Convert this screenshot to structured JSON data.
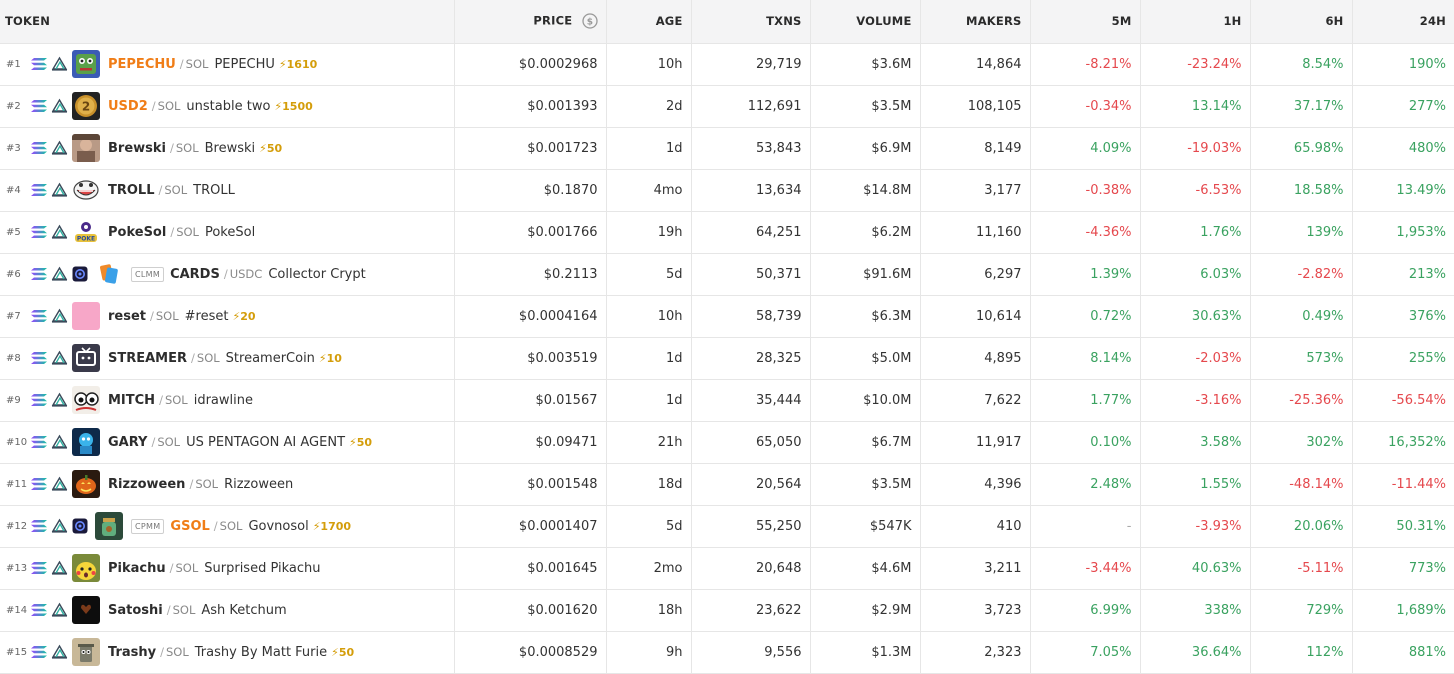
{
  "columns": {
    "token": "TOKEN",
    "price": "PRICE",
    "age": "AGE",
    "txns": "TXNS",
    "volume": "VOLUME",
    "makers": "MAKERS",
    "m5": "5M",
    "h1": "1H",
    "h6": "6H",
    "h24": "24H"
  },
  "colors": {
    "positive": "#3aa260",
    "negative": "#e5484d",
    "highlight_symbol": "#f07d17",
    "boost": "#d49d0a"
  },
  "rows": [
    {
      "rank": "#1",
      "symbol": "PEPECHU",
      "symbol_orange": true,
      "quote": "SOL",
      "name": "PEPECHU",
      "boost": "⚡1610",
      "tag": "",
      "extra_icon": false,
      "price": "$0.0002968",
      "age": "10h",
      "txns": "29,719",
      "volume": "$3.6M",
      "makers": "14,864",
      "m5": "-8.21%",
      "h1": "-23.24%",
      "h6": "8.54%",
      "h24": "190%",
      "avatar": "pepe-avatar"
    },
    {
      "rank": "#2",
      "symbol": "USD2",
      "symbol_orange": true,
      "quote": "SOL",
      "name": "unstable two",
      "boost": "⚡1500",
      "tag": "",
      "extra_icon": false,
      "price": "$0.001393",
      "age": "2d",
      "txns": "112,691",
      "volume": "$3.5M",
      "makers": "108,105",
      "m5": "-0.34%",
      "h1": "13.14%",
      "h6": "37.17%",
      "h24": "277%",
      "avatar": "coin-2-avatar"
    },
    {
      "rank": "#3",
      "symbol": "Brewski",
      "symbol_orange": false,
      "quote": "SOL",
      "name": "Brewski",
      "boost": "⚡50",
      "tag": "",
      "extra_icon": false,
      "price": "$0.001723",
      "age": "1d",
      "txns": "53,843",
      "volume": "$6.9M",
      "makers": "8,149",
      "m5": "4.09%",
      "h1": "-19.03%",
      "h6": "65.98%",
      "h24": "480%",
      "avatar": "photo-avatar"
    },
    {
      "rank": "#4",
      "symbol": "TROLL",
      "symbol_orange": false,
      "quote": "SOL",
      "name": "TROLL",
      "boost": "",
      "tag": "",
      "extra_icon": false,
      "price": "$0.1870",
      "age": "4mo",
      "txns": "13,634",
      "volume": "$14.8M",
      "makers": "3,177",
      "m5": "-0.38%",
      "h1": "-6.53%",
      "h6": "18.58%",
      "h24": "13.49%",
      "avatar": "troll-face-avatar"
    },
    {
      "rank": "#5",
      "symbol": "PokeSol",
      "symbol_orange": false,
      "quote": "SOL",
      "name": "PokeSol",
      "boost": "",
      "tag": "",
      "extra_icon": false,
      "price": "$0.001766",
      "age": "19h",
      "txns": "64,251",
      "volume": "$6.2M",
      "makers": "11,160",
      "m5": "-4.36%",
      "h1": "1.76%",
      "h6": "139%",
      "h24": "1,953%",
      "avatar": "pokesol-logo-avatar"
    },
    {
      "rank": "#6",
      "symbol": "CARDS",
      "symbol_orange": false,
      "quote": "USDC",
      "name": "Collector Crypt",
      "boost": "",
      "tag": "CLMM",
      "extra_icon": true,
      "price": "$0.2113",
      "age": "5d",
      "txns": "50,371",
      "volume": "$91.6M",
      "makers": "6,297",
      "m5": "1.39%",
      "h1": "6.03%",
      "h6": "-2.82%",
      "h24": "213%",
      "avatar": "cards-logo-avatar"
    },
    {
      "rank": "#7",
      "symbol": "reset",
      "symbol_orange": false,
      "quote": "SOL",
      "name": "#reset",
      "boost": "⚡20",
      "tag": "",
      "extra_icon": false,
      "price": "$0.0004164",
      "age": "10h",
      "txns": "58,739",
      "volume": "$6.3M",
      "makers": "10,614",
      "m5": "0.72%",
      "h1": "30.63%",
      "h6": "0.49%",
      "h24": "376%",
      "avatar": "pink-avatar"
    },
    {
      "rank": "#8",
      "symbol": "STREAMER",
      "symbol_orange": false,
      "quote": "SOL",
      "name": "StreamerCoin",
      "boost": "⚡10",
      "tag": "",
      "extra_icon": false,
      "price": "$0.003519",
      "age": "1d",
      "txns": "28,325",
      "volume": "$5.0M",
      "makers": "4,895",
      "m5": "8.14%",
      "h1": "-2.03%",
      "h6": "573%",
      "h24": "255%",
      "avatar": "tv-avatar"
    },
    {
      "rank": "#9",
      "symbol": "MITCH",
      "symbol_orange": false,
      "quote": "SOL",
      "name": "idrawline",
      "boost": "",
      "tag": "",
      "extra_icon": false,
      "price": "$0.01567",
      "age": "1d",
      "txns": "35,444",
      "volume": "$10.0M",
      "makers": "7,622",
      "m5": "1.77%",
      "h1": "-3.16%",
      "h6": "-25.36%",
      "h24": "-56.54%",
      "avatar": "eyes-avatar"
    },
    {
      "rank": "#10",
      "symbol": "GARY",
      "symbol_orange": false,
      "quote": "SOL",
      "name": "US PENTAGON AI AGENT",
      "boost": "⚡50",
      "tag": "",
      "extra_icon": false,
      "price": "$0.09471",
      "age": "21h",
      "txns": "65,050",
      "volume": "$6.7M",
      "makers": "11,917",
      "m5": "0.10%",
      "h1": "3.58%",
      "h6": "302%",
      "h24": "16,352%",
      "avatar": "blue-robot-avatar"
    },
    {
      "rank": "#11",
      "symbol": "Rizzoween",
      "symbol_orange": false,
      "quote": "SOL",
      "name": "Rizzoween",
      "boost": "",
      "tag": "",
      "extra_icon": false,
      "price": "$0.001548",
      "age": "18d",
      "txns": "20,564",
      "volume": "$3.5M",
      "makers": "4,396",
      "m5": "2.48%",
      "h1": "1.55%",
      "h6": "-48.14%",
      "h24": "-11.44%",
      "avatar": "pumpkin-avatar"
    },
    {
      "rank": "#12",
      "symbol": "GSOL",
      "symbol_orange": true,
      "quote": "SOL",
      "name": "Govnosol",
      "boost": "⚡1700",
      "tag": "CPMM",
      "extra_icon": true,
      "price": "$0.0001407",
      "age": "5d",
      "txns": "55,250",
      "volume": "$547K",
      "makers": "410",
      "m5": "-",
      "h1": "-3.93%",
      "h6": "20.06%",
      "h24": "50.31%",
      "avatar": "jar-avatar"
    },
    {
      "rank": "#13",
      "symbol": "Pikachu",
      "symbol_orange": false,
      "quote": "SOL",
      "name": "Surprised Pikachu",
      "boost": "",
      "tag": "",
      "extra_icon": false,
      "price": "$0.001645",
      "age": "2mo",
      "txns": "20,648",
      "volume": "$4.6M",
      "makers": "3,211",
      "m5": "-3.44%",
      "h1": "40.63%",
      "h6": "-5.11%",
      "h24": "773%",
      "avatar": "pikachu-avatar"
    },
    {
      "rank": "#14",
      "symbol": "Satoshi",
      "symbol_orange": false,
      "quote": "SOL",
      "name": "Ash Ketchum",
      "boost": "",
      "tag": "",
      "extra_icon": false,
      "price": "$0.001620",
      "age": "18h",
      "txns": "23,622",
      "volume": "$2.9M",
      "makers": "3,723",
      "m5": "6.99%",
      "h1": "338%",
      "h6": "729%",
      "h24": "1,689%",
      "avatar": "dark-avatar"
    },
    {
      "rank": "#15",
      "symbol": "Trashy",
      "symbol_orange": false,
      "quote": "SOL",
      "name": "Trashy By Matt Furie",
      "boost": "⚡50",
      "tag": "",
      "extra_icon": false,
      "price": "$0.0008529",
      "age": "9h",
      "txns": "9,556",
      "volume": "$1.3M",
      "makers": "2,323",
      "m5": "7.05%",
      "h1": "36.64%",
      "h6": "112%",
      "h24": "881%",
      "avatar": "trash-can-avatar"
    }
  ]
}
